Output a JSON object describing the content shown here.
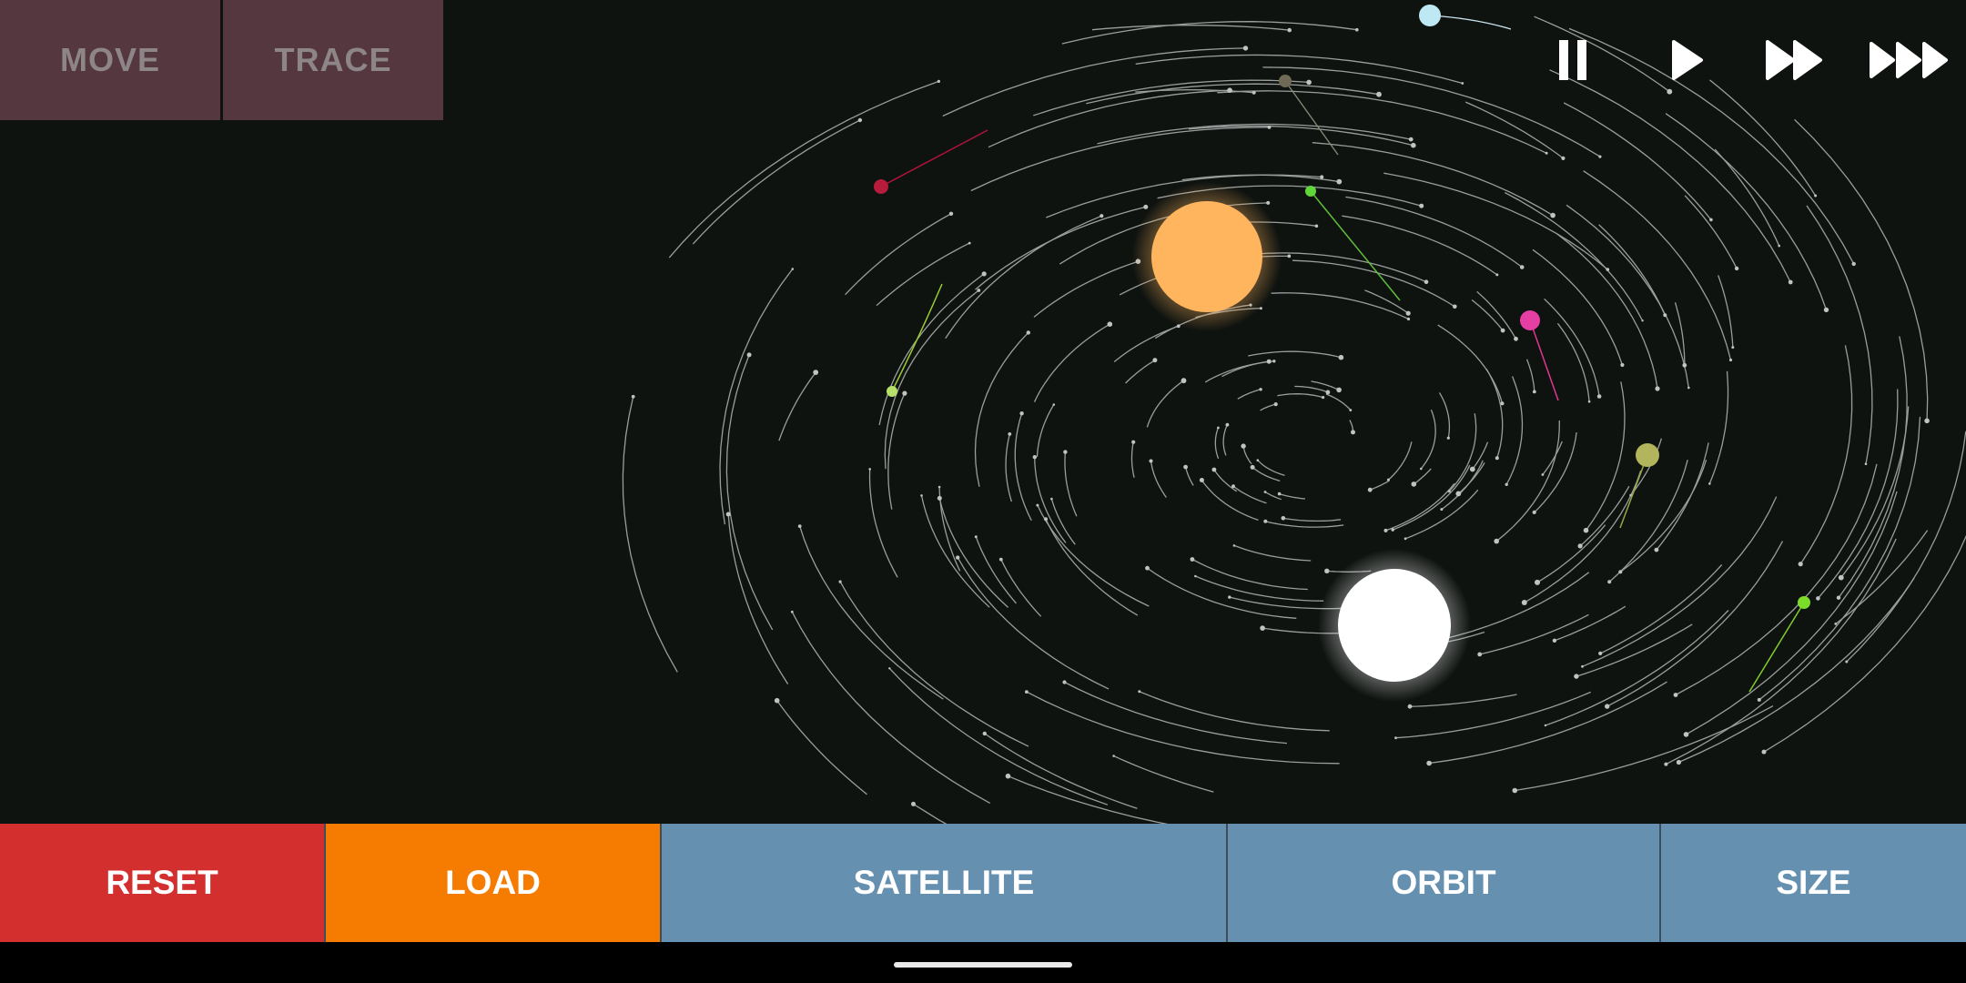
{
  "modes": {
    "move": "MOVE",
    "trace": "TRACE"
  },
  "speed_controls": [
    "pause-icon",
    "play-icon",
    "fast-forward-icon",
    "fastest-forward-icon"
  ],
  "bottom_bar": {
    "reset": "RESET",
    "load": "LOAD",
    "satellite": "SATELLITE",
    "orbit": "ORBIT",
    "size": "SIZE"
  },
  "colors": {
    "background": "#0f1310",
    "mode_button": "#54373f",
    "reset": "#d32f2f",
    "load": "#f57c00",
    "tool_button": "#6690b0",
    "sun_orange": "#ffb55e",
    "sun_white": "#ffffff"
  }
}
